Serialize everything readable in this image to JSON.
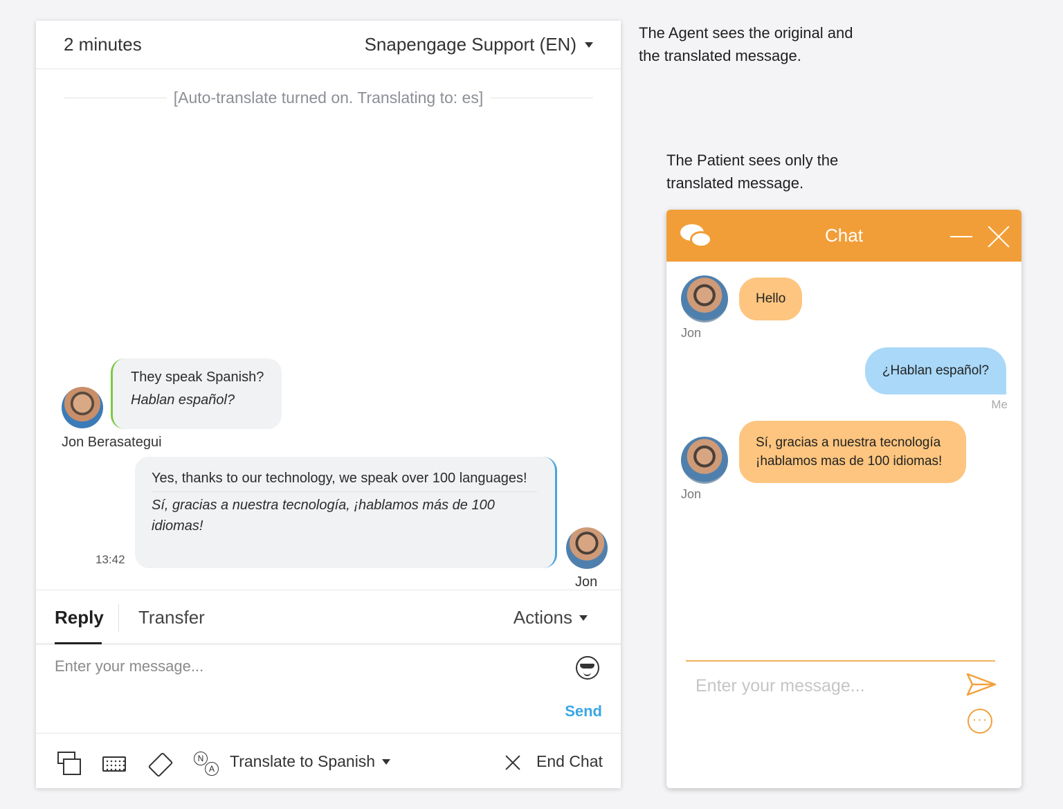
{
  "agent": {
    "duration": "2 minutes",
    "queue": "Snapengage Support (EN)",
    "system_message": "[Auto-translate turned on. Translating to: es]",
    "messages": [
      {
        "sender": "Jon Berasategui",
        "original": "They speak Spanish?",
        "translated": "Hablan español?"
      },
      {
        "sender": "Jon",
        "original": "Yes, thanks to our technology, we speak over 100 languages!",
        "translated": "Sí, gracias a nuestra tecnología, ¡hablamos más de 100 idiomas!",
        "time": "13:42"
      }
    ],
    "tabs": {
      "reply": "Reply",
      "transfer": "Transfer",
      "actions": "Actions"
    },
    "composer_placeholder": "Enter your message...",
    "send_label": "Send",
    "toolbar": {
      "translate_label": "Translate to Spanish",
      "end_chat_label": "End Chat"
    },
    "accent_color": "#3aa6e4"
  },
  "captions": {
    "agent": "The Agent sees the original and the translated message.",
    "patient": "The Patient sees only the translated message."
  },
  "patient": {
    "title": "Chat",
    "messages": [
      {
        "sender": "Jon",
        "text": "Hello"
      },
      {
        "sender": "Me",
        "text": "¿Hablan español?"
      },
      {
        "sender": "Jon",
        "text": "Sí, gracias a nuestra tecnología ¡hablamos mas de 100 idiomas!"
      }
    ],
    "input_placeholder": "Enter your message...",
    "header_color": "#f29e38",
    "agent_bubble_color": "#fdc57f",
    "me_bubble_color": "#a9d8f8"
  }
}
